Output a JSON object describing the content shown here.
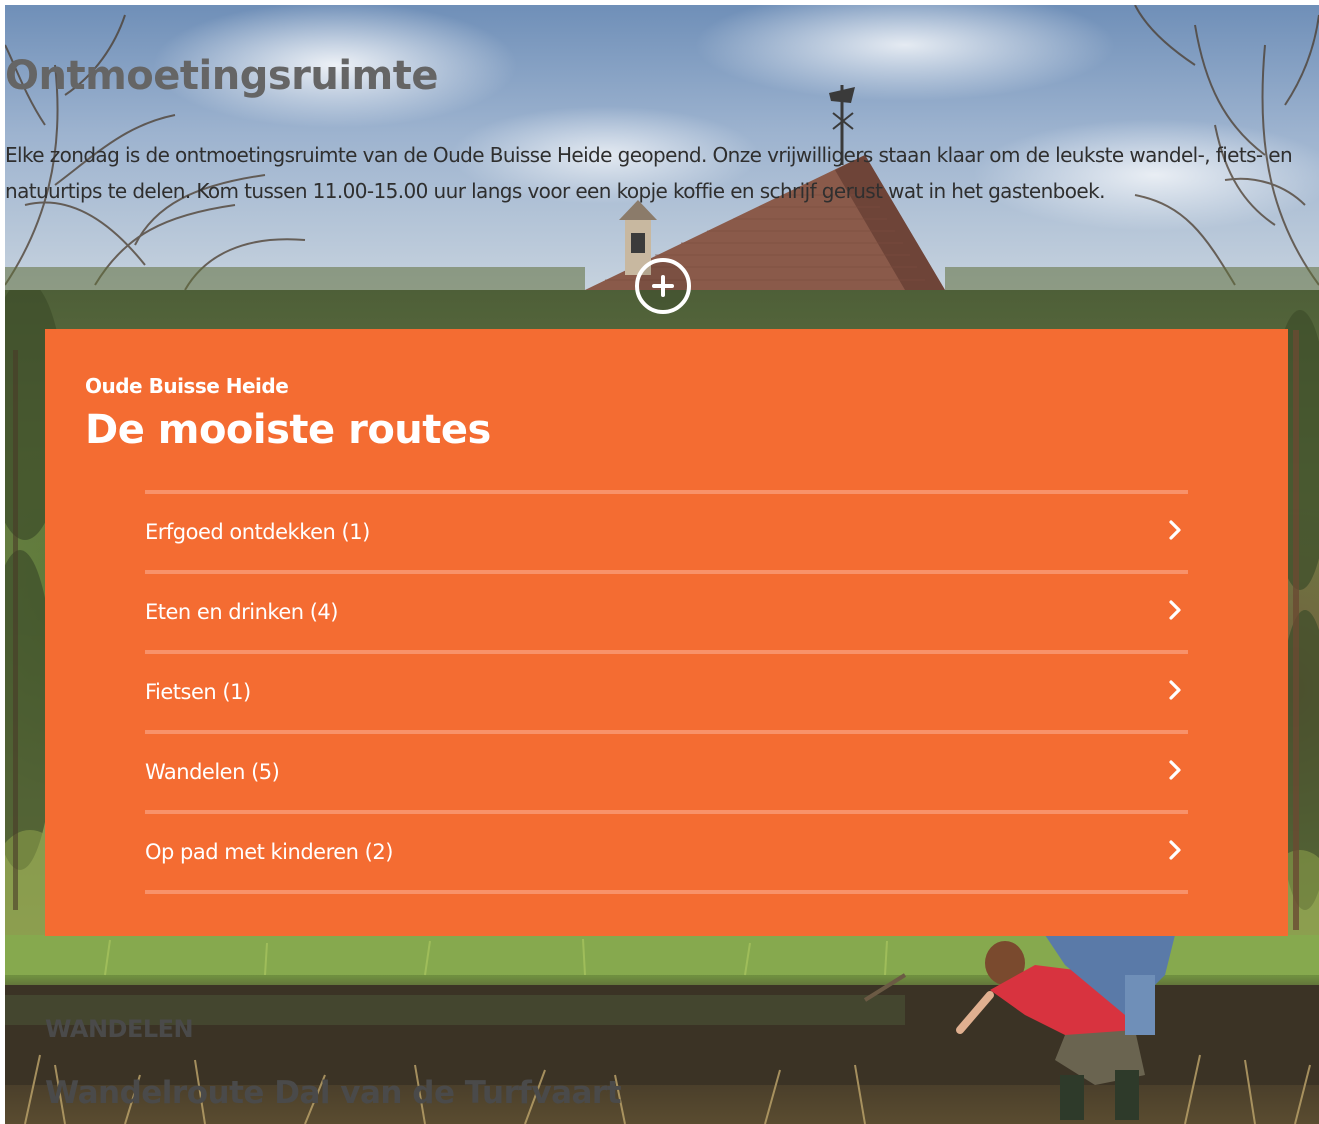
{
  "intro": {
    "title": "Ontmoetingsruimte",
    "text": "Elke zondag is de ontmoetingsruimte van de Oude Buisse Heide geopend. Onze vrijwilligers staan klaar om de leukste wandel-, fiets- en natuurtips te delen. Kom tussen 11.00-15.00 uur langs voor een kopje koffie en schrijf gerust wat in het gastenboek.",
    "expand_icon": "plus-circle-icon"
  },
  "routes": {
    "eyebrow": "Oude Buisse Heide",
    "heading": "De mooiste routes",
    "items": [
      {
        "label": "Erfgoed ontdekken (1)"
      },
      {
        "label": "Eten en drinken (4)"
      },
      {
        "label": "Fietsen (1)"
      },
      {
        "label": "Wandelen (5)"
      },
      {
        "label": "Op pad met kinderen (2)"
      }
    ],
    "item_icon": "chevron-right-icon"
  },
  "teaser": {
    "category": "Wandelen",
    "title": "Wandelroute Dal van de Turfvaart"
  },
  "colors": {
    "panel": "#f46c32",
    "divider": "#f8926a",
    "heading_gray": "#656565"
  }
}
